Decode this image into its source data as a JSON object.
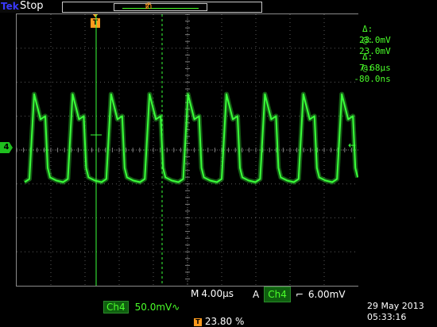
{
  "status": {
    "brand": "Tek",
    "acq_state": "Stop"
  },
  "trigger_marker": {
    "label": "T"
  },
  "channel": {
    "id": "4",
    "name": "Ch4",
    "scale": "50.0mV",
    "coupling_symbol": "∿",
    "color": "#3aff3a"
  },
  "cursors": {
    "rows": [
      {
        "label": "Δ:",
        "value": "23.0mV"
      },
      {
        "label": "@:",
        "value": "23.0mV"
      },
      {
        "label": "Δ:",
        "value": "7.68µs"
      },
      {
        "label": "@:",
        "value": "-80.0ns"
      }
    ]
  },
  "timebase": {
    "label": "M",
    "value": "4.00µs"
  },
  "trigger": {
    "mode": "A",
    "source": "Ch4",
    "slope_symbol": "⌐",
    "level": "6.00mV"
  },
  "horizontal_position": {
    "icon": "T",
    "value": "23.80 %"
  },
  "datetime": {
    "date": "29 May 2013",
    "time": "05:33:16"
  },
  "waveform": {
    "type": "pulse-train",
    "cycles": 9,
    "high_level_div": 1.0,
    "low_level_div": -0.9,
    "overshoot_div": 1.6,
    "color": "#3aff3a"
  }
}
